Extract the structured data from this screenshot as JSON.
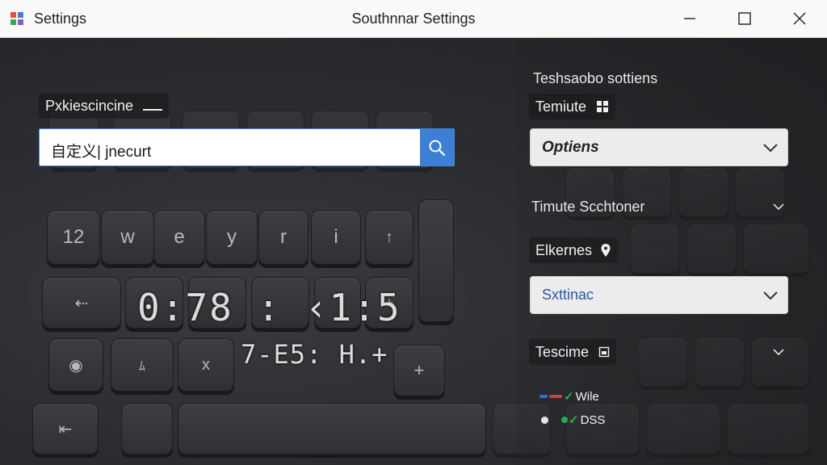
{
  "titlebar": {
    "app_name": "Settings",
    "window_title": "Southnnar Settings"
  },
  "left": {
    "section_label": "Pxkiescincine",
    "search": {
      "value": "自定义| jnecurt"
    },
    "keys": [
      "12",
      "w",
      "e",
      "y",
      "r",
      "i",
      "↑",
      "+",
      "x",
      "+",
      "ﾑ",
      "⇠"
    ],
    "clock_primary": "0:78 : ‹1:5",
    "clock_secondary": "7-E5: H.+"
  },
  "right": {
    "heading": "Teshsaobo sottiens",
    "theme_label": "Temiute",
    "dropdown1": {
      "value": "Optiens"
    },
    "section2_label": "Timute Scchtoner",
    "elements_label": "Elkernes",
    "dropdown2": {
      "value": "Sxttinac"
    },
    "tescime_label": "Tescime",
    "legend": [
      {
        "label": "Wile",
        "colors": [
          "#2f6fd8",
          "#d83a3a",
          "#2fa84a"
        ]
      },
      {
        "label": "DSS",
        "colors": [
          "#e6e6e6",
          "#2fa84a"
        ]
      }
    ]
  }
}
